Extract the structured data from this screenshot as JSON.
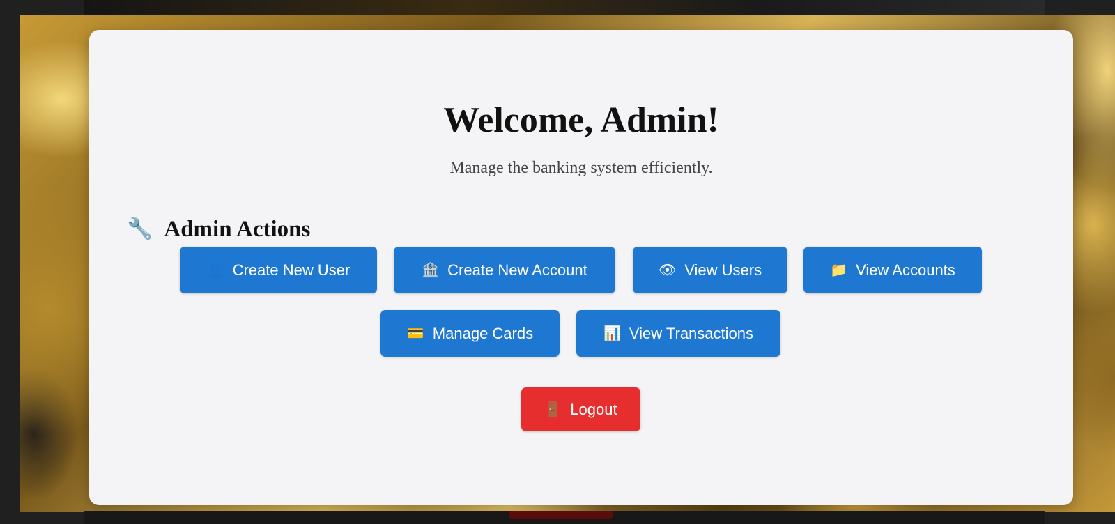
{
  "header": {
    "title": "Welcome, Admin!",
    "subtitle": "Manage the banking system efficiently."
  },
  "section": {
    "icon": "wrench-icon",
    "title": "Admin Actions"
  },
  "actions": [
    {
      "icon": "user-icon",
      "glyph": "👤",
      "label": "Create New User"
    },
    {
      "icon": "bank-icon",
      "glyph": "🏦",
      "label": "Create New Account"
    },
    {
      "icon": "eye-icon",
      "glyph": "👁",
      "label": "View Users"
    },
    {
      "icon": "folder-icon",
      "glyph": "📁",
      "label": "View Accounts"
    },
    {
      "icon": "credit-card-icon",
      "glyph": "💳",
      "label": "Manage Cards"
    },
    {
      "icon": "bar-chart-icon",
      "glyph": "📊",
      "label": "View Transactions"
    }
  ],
  "logout": {
    "icon": "door-icon",
    "glyph": "🚪",
    "label": "Logout"
  },
  "colors": {
    "primary_button": "#1e77d0",
    "logout_button": "#e62e2e",
    "card_background": "#f4f4f7"
  }
}
